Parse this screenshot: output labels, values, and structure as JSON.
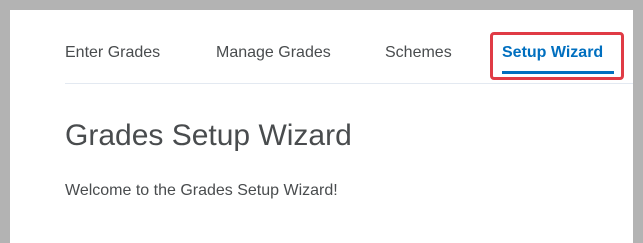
{
  "nav": {
    "tabs": [
      {
        "label": "Enter Grades",
        "selected": false
      },
      {
        "label": "Manage Grades",
        "selected": false
      },
      {
        "label": "Schemes",
        "selected": false
      },
      {
        "label": "Setup Wizard",
        "selected": true
      }
    ]
  },
  "main": {
    "title": "Grades Setup Wizard",
    "welcome": "Welcome to the Grades Setup Wizard!"
  },
  "colors": {
    "accent": "#006fbf",
    "highlight": "#e03b45",
    "text": "#494c4e"
  }
}
